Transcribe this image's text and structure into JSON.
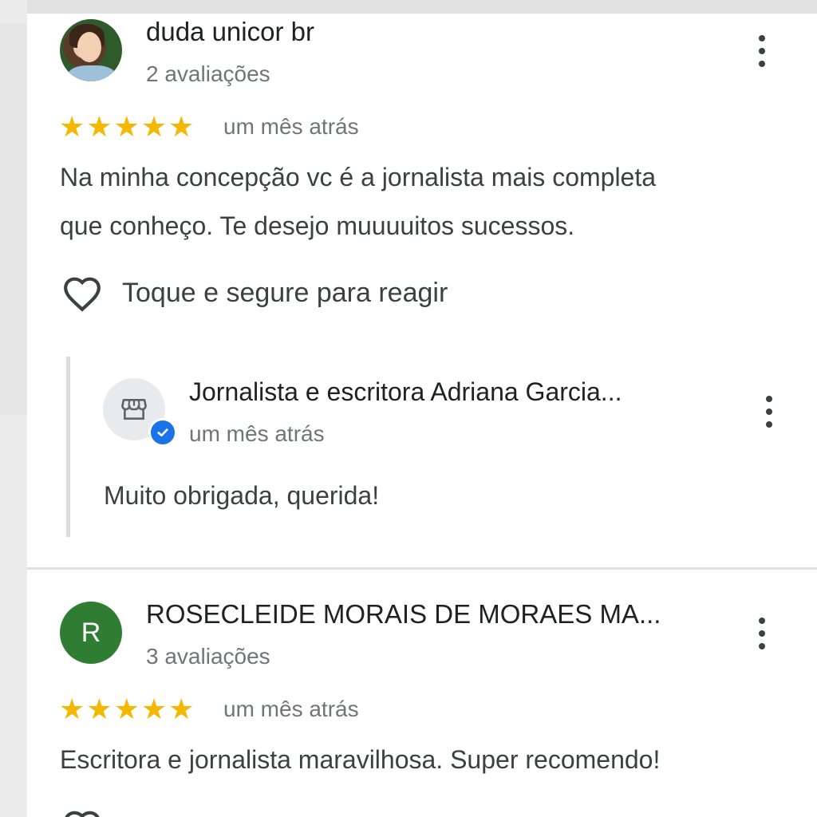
{
  "reviews": [
    {
      "author": "duda unicor br",
      "review_count": "2 avaliações",
      "rating": 5,
      "stars": [
        "★",
        "★",
        "★",
        "★",
        "★"
      ],
      "time": "um mês atrás",
      "text_line1": "Na minha concepção vc é a jornalista mais completa",
      "text_line2": "que conheço. Te desejo muuuuitos sucessos.",
      "react_label": "Toque e segure para reagir",
      "owner_reply": {
        "author": "Jornalista e escritora Adriana Garcia...",
        "time": "um mês atrás",
        "text": "Muito obrigada, querida!"
      }
    },
    {
      "author": "ROSECLEIDE MORAIS DE MORAES MA...",
      "avatar_letter": "R",
      "review_count": "3 avaliações",
      "rating": 5,
      "stars": [
        "★",
        "★",
        "★",
        "★",
        "★"
      ],
      "time": "um mês atrás",
      "text": "Escritora e jornalista maravilhosa. Super recomendo!"
    }
  ],
  "colors": {
    "star": "#f5b800",
    "avatar_green": "#2e7d32",
    "verified_blue": "#1a73e8"
  },
  "icons": {
    "more": "more-vert-icon",
    "heart": "heart-outline-icon",
    "store": "storefront-icon",
    "verified": "verified-check-icon"
  }
}
